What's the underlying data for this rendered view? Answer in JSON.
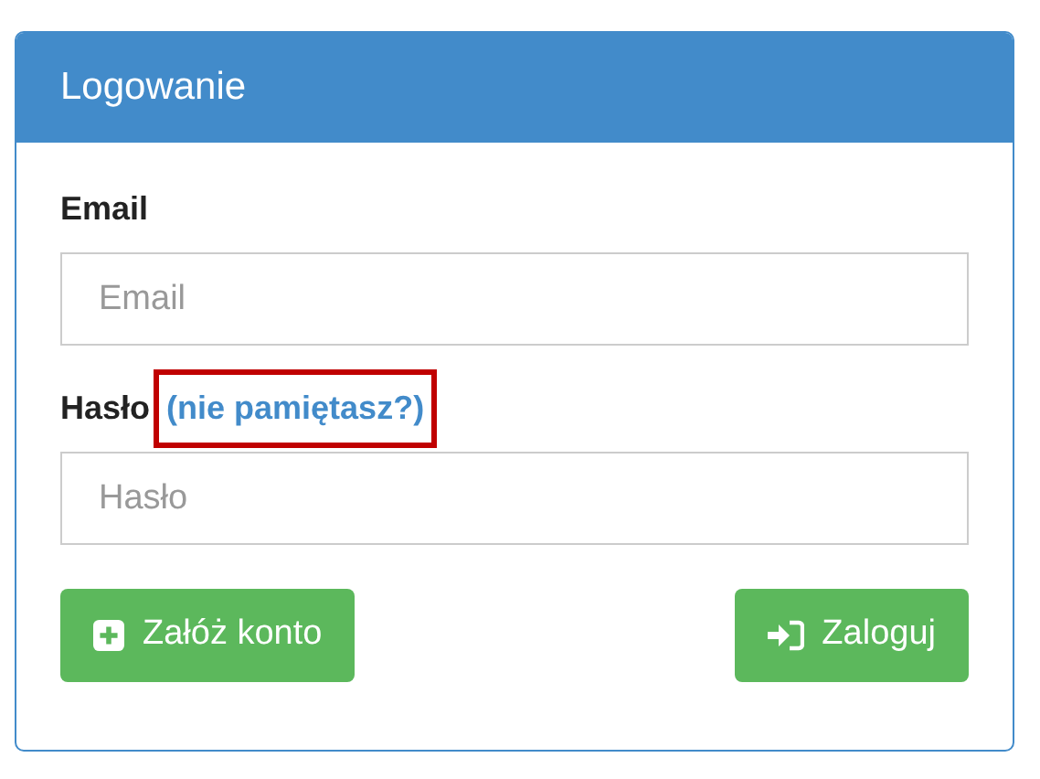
{
  "panel": {
    "title": "Logowanie"
  },
  "fields": [
    {
      "label": "Email",
      "placeholder": "Email"
    },
    {
      "label": "Hasło",
      "link": {
        "text": "(nie pamiętasz?)",
        "highlighted": true
      },
      "placeholder": "Hasło"
    }
  ],
  "buttons": [
    {
      "label": "Załóż konto",
      "kind": "register"
    },
    {
      "label": "Zaloguj",
      "kind": "login"
    }
  ]
}
